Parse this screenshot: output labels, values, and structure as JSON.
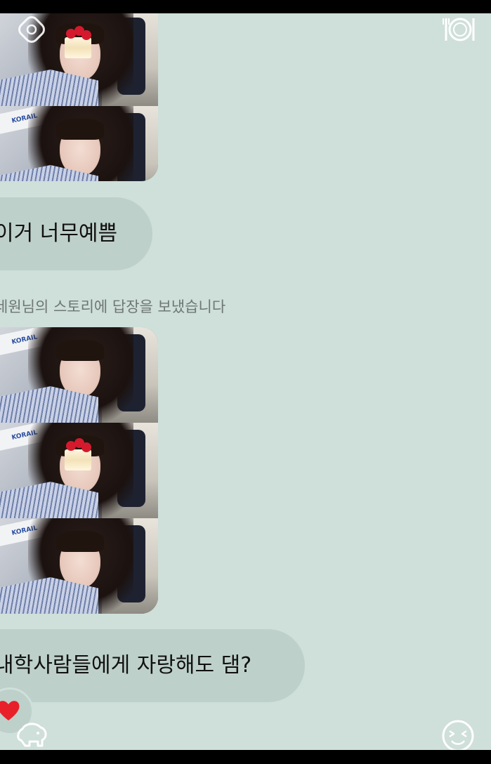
{
  "messages": {
    "message_1": "이거 너무예쁨",
    "story_reply_note": "네원님의 스토리에 답장을 보냈습니다",
    "message_2": "내학사람들에게 자랑해도 댐?"
  },
  "photo_badge_text": "KORAIL",
  "reaction_emoji": "heart",
  "icons": {
    "top_left": "sticker-icon",
    "top_right": "dish-icon",
    "bottom_left": "elephant-sticker-icon",
    "bottom_right": "emoji-face-icon"
  },
  "colors": {
    "background": "#cfdfd9",
    "bubble": "#bed0ca",
    "text": "#111111",
    "note": "#6e7673",
    "heart": "#e8202a"
  }
}
